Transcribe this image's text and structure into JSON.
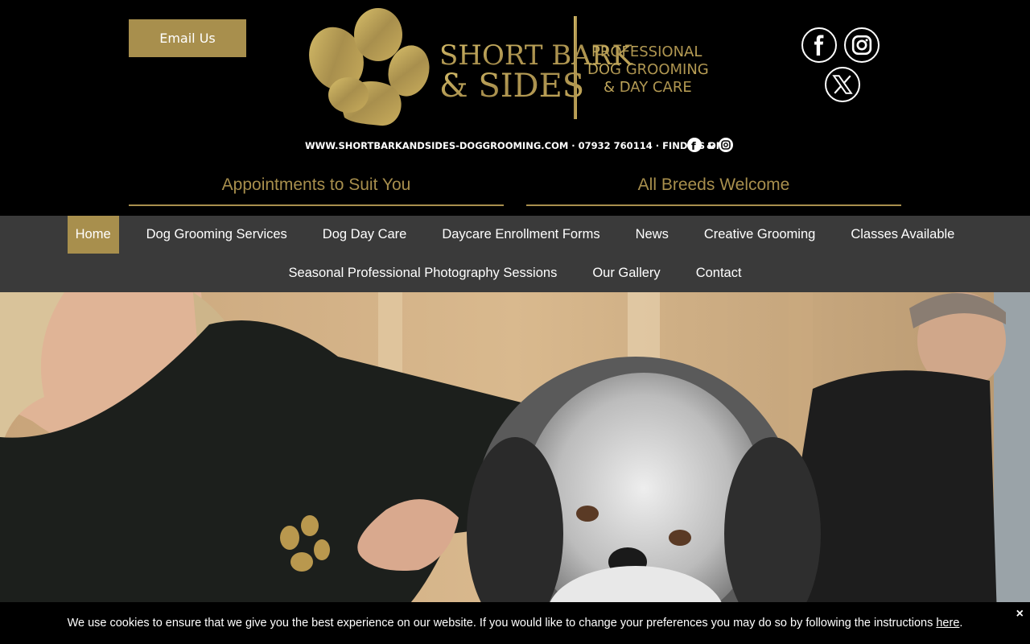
{
  "header": {
    "email_button": "Email Us",
    "logo": {
      "name_line1": "SHORT BARK",
      "name_line2": "& SIDES",
      "desc_line1": "PROFESSIONAL",
      "desc_line2": "DOG GROOMING",
      "desc_line3": "& DAY CARE",
      "contact_line": "WWW.SHORTBARKANDSIDES-DOGGROOMING.COM · 07932 760114 · FIND US ON",
      "contact_amp": "&"
    },
    "social": [
      {
        "icon": "facebook-icon"
      },
      {
        "icon": "instagram-icon"
      },
      {
        "icon": "x-twitter-icon"
      }
    ],
    "tagline_left": "Appointments to Suit You",
    "tagline_right": "All Breeds Welcome"
  },
  "nav": {
    "row1": [
      "Home",
      "Dog Grooming Services",
      "Dog Day Care",
      "Daycare Enrollment Forms",
      "News",
      "Creative Grooming",
      "Classes Available"
    ],
    "row2": [
      "Seasonal Professional Photography Sessions",
      "Our Gallery",
      "Contact"
    ],
    "active": "Home"
  },
  "cookie": {
    "text": "We use cookies to ensure that we give you the best experience on our website. If you would like to change your preferences you may do so by following the instructions ",
    "link": "here",
    "after": ".",
    "close": "×"
  },
  "colors": {
    "gold": "#a88f4d",
    "nav_bg": "#3a3a3a",
    "header_bg": "#000000"
  }
}
